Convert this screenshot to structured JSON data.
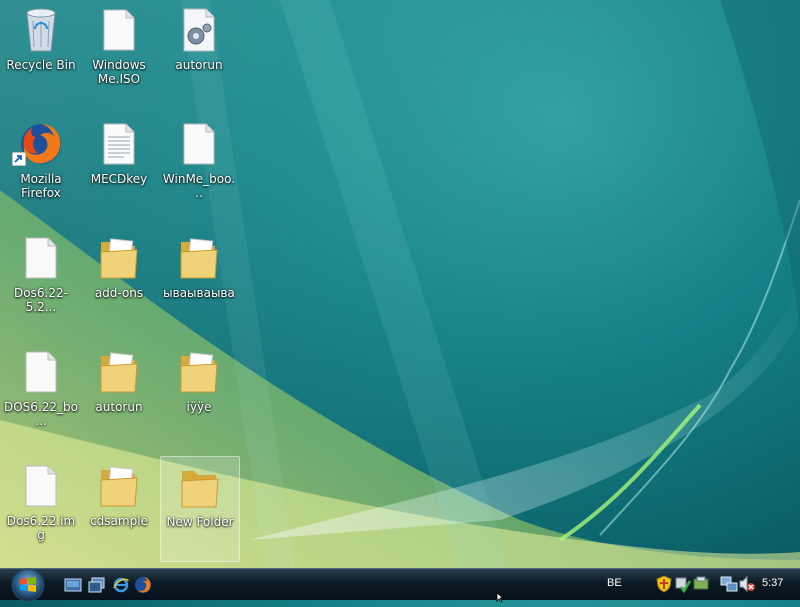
{
  "desktop": {
    "icons": [
      {
        "label": "Recycle Bin",
        "icon": "recycle-bin-icon"
      },
      {
        "label": "Windows Me.ISO",
        "icon": "file-icon"
      },
      {
        "label": "autorun",
        "icon": "settings-file-icon"
      },
      {
        "label": "Mozilla Firefox",
        "icon": "firefox-icon"
      },
      {
        "label": "MECDkey",
        "icon": "text-file-icon"
      },
      {
        "label": "WinMe_boo...",
        "icon": "file-icon"
      },
      {
        "label": "Dos6.22-5.2...",
        "icon": "file-icon"
      },
      {
        "label": "add-ons",
        "icon": "folder-icon"
      },
      {
        "label": "ываываыва",
        "icon": "folder-icon"
      },
      {
        "label": "DOS6.22_bo...",
        "icon": "file-icon"
      },
      {
        "label": "autorun",
        "icon": "folder-icon"
      },
      {
        "label": "iÿÿe",
        "icon": "folder-icon"
      },
      {
        "label": "Dos6.22.img",
        "icon": "file-icon"
      },
      {
        "label": "cdsample",
        "icon": "folder-icon"
      },
      {
        "label": "New Folder",
        "icon": "folder-icon",
        "selected": true
      }
    ]
  },
  "taskbar": {
    "start_icon": "windows-start-orb-icon",
    "quick_launch": [
      "show-desktop-icon",
      "switch-windows-icon",
      "internet-explorer-icon",
      "firefox-icon"
    ],
    "language": "BE",
    "tray_icons": [
      "security-shield-icon",
      "network-status-icon",
      "safely-remove-hardware-icon",
      "network-icon",
      "volume-muted-icon"
    ],
    "clock": "5:37"
  },
  "colors": {
    "accent": "#137f86",
    "taskbar": "#0d1a24",
    "folder": "#e8c766"
  }
}
